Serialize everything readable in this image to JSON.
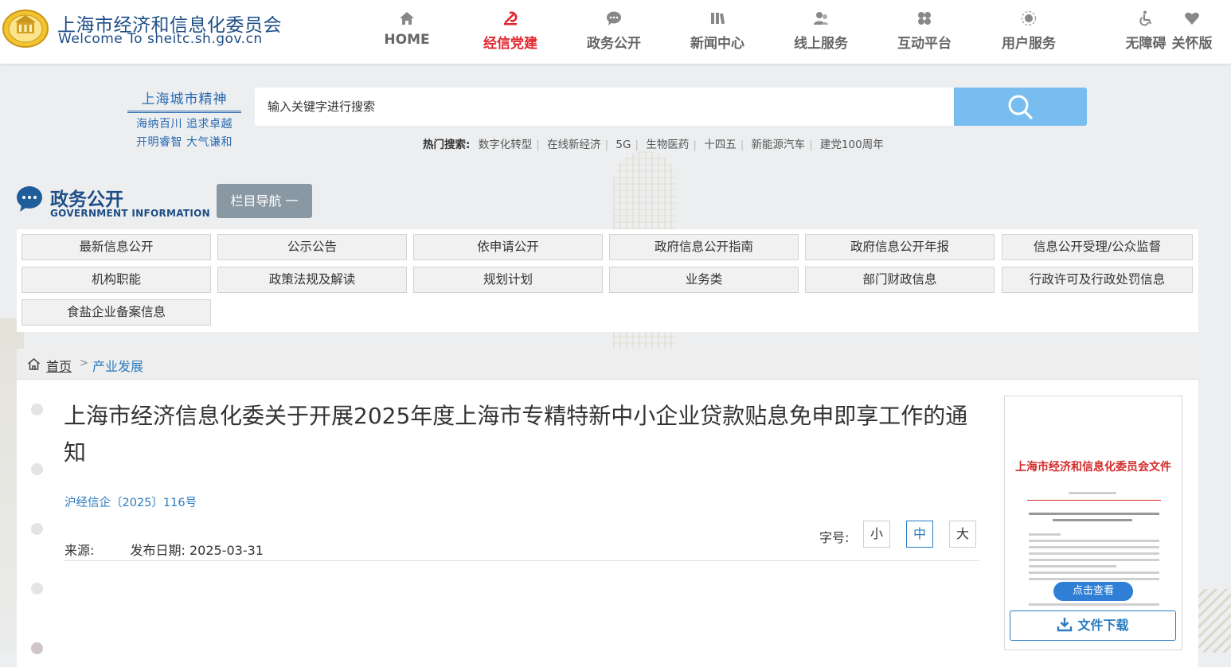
{
  "site": {
    "title_cn": "上海市经济和信息化委员会",
    "title_en": "Welcome To sheitc.sh.gov.cn"
  },
  "nav": {
    "items": [
      {
        "label": "HOME",
        "icon": "home-icon"
      },
      {
        "label": "经信党建",
        "icon": "party-emblem-icon",
        "active": true
      },
      {
        "label": "政务公开",
        "icon": "chat-icon"
      },
      {
        "label": "新闻中心",
        "icon": "newspaper-icon"
      },
      {
        "label": "线上服务",
        "icon": "service-user-icon"
      },
      {
        "label": "互动平台",
        "icon": "interaction-icon"
      },
      {
        "label": "用户服务",
        "icon": "user-service-icon"
      }
    ],
    "accessibility": {
      "label": "无障碍",
      "icon": "wheelchair-icon"
    },
    "care_mode": {
      "label": "关怀版",
      "icon": "heart-icon"
    },
    "active_color": "#e0262d"
  },
  "motto": {
    "title": "上海城市精神",
    "line1": "海纳百川 追求卓越",
    "line2": "开明睿智 大气谦和"
  },
  "search": {
    "placeholder": "输入关键字进行搜索",
    "button_icon": "search-icon",
    "button_color": "#78bdf0",
    "hot_label": "热门搜索:",
    "hot_terms": [
      "数字化转型",
      "在线新经济",
      "5G",
      "生物医药",
      "十四五",
      "新能源汽车",
      "建党100周年"
    ]
  },
  "section": {
    "title": "政务公开",
    "subtitle": "GOVERNMENT INFORMATION",
    "nav_button": "栏目导航 一",
    "icon": "chat-bubble-icon"
  },
  "categories": [
    "最新信息公开",
    "公示公告",
    "依申请公开",
    "政府信息公开指南",
    "政府信息公开年报",
    "信息公开受理/公众监督",
    "机构职能",
    "政策法规及解读",
    "规划计划",
    "业务类",
    "部门财政信息",
    "行政许可及行政处罚信息",
    "食盐企业备案信息"
  ],
  "breadcrumb": {
    "home": "首页",
    "separator": ">",
    "current": "产业发展",
    "icon": "home-outline-icon"
  },
  "article": {
    "title": "上海市经济信息化委关于开展2025年度上海市专精特新中小企业贷款贴息免申即享工作的通知",
    "doc_number": "沪经信企〔2025〕116号",
    "source_label": "来源:",
    "date_label": "发布日期:",
    "date": "2025-03-31",
    "font_size_label": "字号:",
    "font_sizes": [
      {
        "label": "小"
      },
      {
        "label": "中",
        "active": true
      },
      {
        "label": "大"
      }
    ]
  },
  "preview": {
    "doc_header": "上海市经济和信息化委员会文件",
    "view_label": "点击查看",
    "download_label": "文件下载",
    "download_icon": "download-icon"
  },
  "accent_color": "#2a7bc0"
}
